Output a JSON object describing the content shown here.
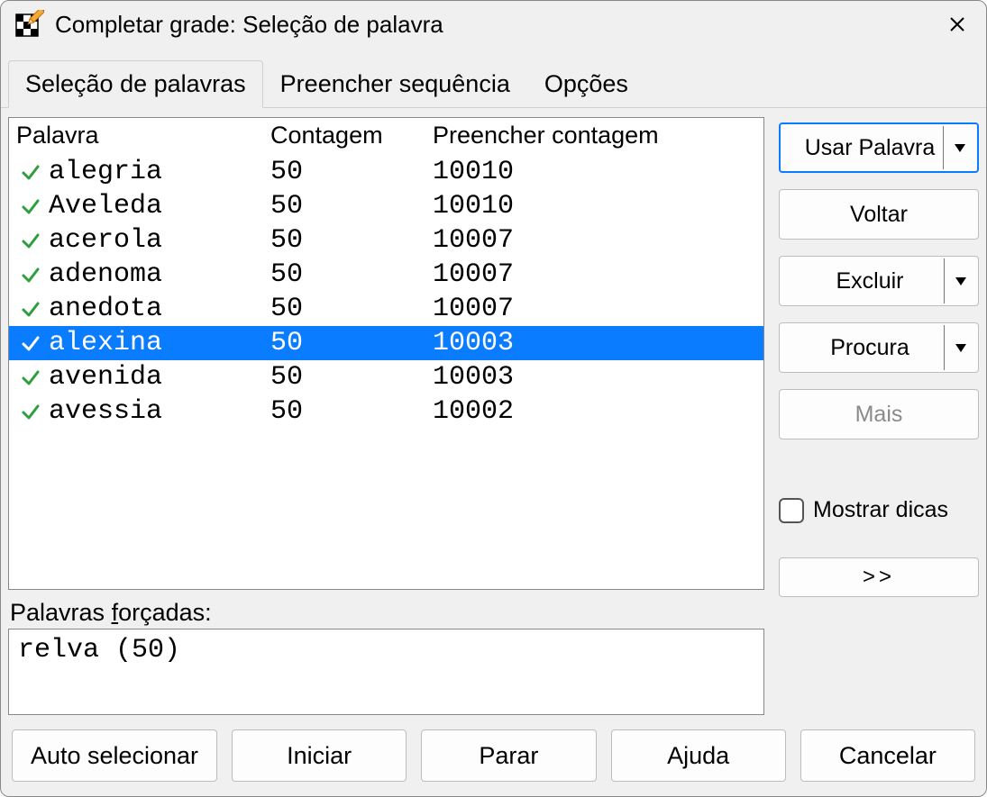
{
  "window": {
    "title": "Completar grade: Seleção de palavra"
  },
  "tabs": {
    "t0": "Seleção de palavras",
    "t1": "Preencher sequência",
    "t2": "Opções"
  },
  "columns": {
    "word": "Palavra",
    "count": "Contagem",
    "fill": "Preencher contagem"
  },
  "rows": [
    {
      "word": "alegria",
      "count": "50",
      "fill": "10010",
      "selected": false
    },
    {
      "word": "Aveleda",
      "count": "50",
      "fill": "10010",
      "selected": false
    },
    {
      "word": "acerola",
      "count": "50",
      "fill": "10007",
      "selected": false
    },
    {
      "word": "adenoma",
      "count": "50",
      "fill": "10007",
      "selected": false
    },
    {
      "word": "anedota",
      "count": "50",
      "fill": "10007",
      "selected": false
    },
    {
      "word": "alexina",
      "count": "50",
      "fill": "10003",
      "selected": true
    },
    {
      "word": "avenida",
      "count": "50",
      "fill": "10003",
      "selected": false
    },
    {
      "word": "avessia",
      "count": "50",
      "fill": "10002",
      "selected": false
    }
  ],
  "forced": {
    "label_prefix": "Palavras ",
    "label_underlined": "f",
    "label_suffix": "orçadas:",
    "value": "relva (50)"
  },
  "sidebar": {
    "use_word": "Usar Palavra",
    "back": "Voltar",
    "exclude": "Excluir",
    "search": "Procura",
    "more": "Mais",
    "show_hints": "Mostrar dicas",
    "expand": ">>"
  },
  "bottom": {
    "auto": "Auto selecionar",
    "start": "Iniciar",
    "stop": "Parar",
    "help": "Ajuda",
    "cancel": "Cancelar"
  }
}
